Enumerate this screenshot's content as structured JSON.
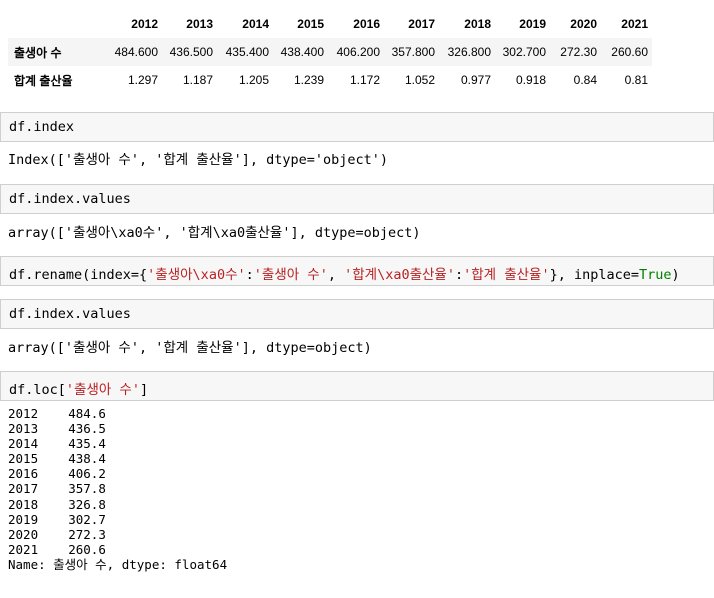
{
  "table": {
    "columns": [
      "2012",
      "2013",
      "2014",
      "2015",
      "2016",
      "2017",
      "2018",
      "2019",
      "2020",
      "2021"
    ],
    "rows": [
      {
        "label": "출생아 수",
        "values": [
          "484.600",
          "436.500",
          "435.400",
          "438.400",
          "406.200",
          "357.800",
          "326.800",
          "302.700",
          "272.30",
          "260.60"
        ]
      },
      {
        "label": "합계 출산율",
        "values": [
          "1.297",
          "1.187",
          "1.205",
          "1.239",
          "1.172",
          "1.052",
          "0.977",
          "0.918",
          "0.84",
          "0.81"
        ]
      }
    ]
  },
  "cells": [
    {
      "code": "df.index",
      "output": "Index(['출생아 수', '합계 출산율'], dtype='object')"
    },
    {
      "code": "df.index.values",
      "output": "array(['출생아\\xa0수', '합계\\xa0출산율'], dtype=object)"
    },
    {
      "code_parts": {
        "p1": "df.rename(index={",
        "s1": "'출생아\\xa0수'",
        "c1": ":",
        "s2": "'출생아 수'",
        "c2": ", ",
        "s3": "'합계\\xa0출산율'",
        "c3": ":",
        "s4": "'합계 출산율'",
        "p2": "}, inplace=",
        "kw": "True",
        "p3": ")"
      }
    },
    {
      "code": "df.index.values",
      "output": "array(['출생아 수', '합계 출산율'], dtype=object)"
    },
    {
      "code_parts": {
        "p1": "df.loc[",
        "s1": "'출생아 수'",
        "p2": "]"
      }
    }
  ],
  "series": {
    "rows": [
      {
        "year": "2012",
        "value": "484.6"
      },
      {
        "year": "2013",
        "value": "436.5"
      },
      {
        "year": "2014",
        "value": "435.4"
      },
      {
        "year": "2015",
        "value": "438.4"
      },
      {
        "year": "2016",
        "value": "406.2"
      },
      {
        "year": "2017",
        "value": "357.8"
      },
      {
        "year": "2018",
        "value": "326.8"
      },
      {
        "year": "2019",
        "value": "302.7"
      },
      {
        "year": "2020",
        "value": "272.3"
      },
      {
        "year": "2021",
        "value": "260.6"
      }
    ],
    "footer": "Name: 출생아 수, dtype: float64"
  }
}
